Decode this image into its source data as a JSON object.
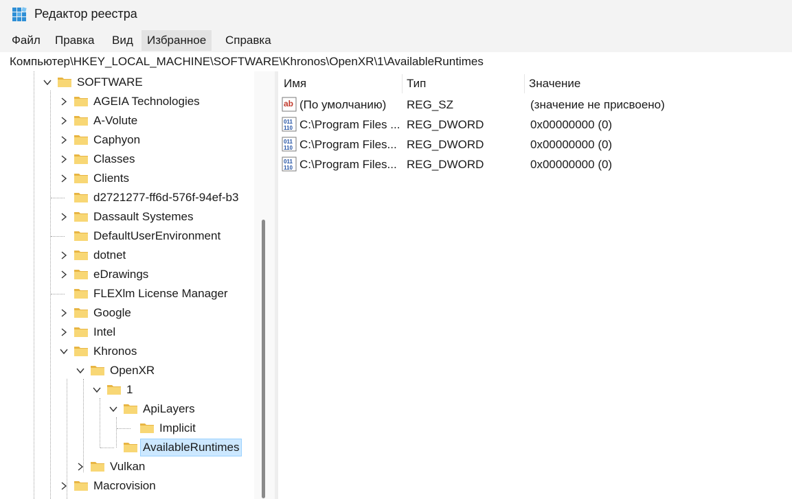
{
  "window": {
    "title": "Редактор реестра"
  },
  "menu": [
    "Файл",
    "Правка",
    "Вид",
    "Избранное",
    "Справка"
  ],
  "address": "Компьютер\\HKEY_LOCAL_MACHINE\\SOFTWARE\\Khronos\\OpenXR\\1\\AvailableRuntimes",
  "tree": {
    "items": [
      {
        "label": "SOFTWARE",
        "level": 0,
        "state": "expanded"
      },
      {
        "label": "AGEIA Technologies",
        "level": 1,
        "state": "collapsed"
      },
      {
        "label": "A-Volute",
        "level": 1,
        "state": "collapsed"
      },
      {
        "label": "Caphyon",
        "level": 1,
        "state": "collapsed"
      },
      {
        "label": "Classes",
        "level": 1,
        "state": "collapsed"
      },
      {
        "label": "Clients",
        "level": 1,
        "state": "collapsed"
      },
      {
        "label": "d2721277-ff6d-576f-94ef-b3",
        "level": 1,
        "state": "leaf"
      },
      {
        "label": "Dassault Systemes",
        "level": 1,
        "state": "collapsed"
      },
      {
        "label": "DefaultUserEnvironment",
        "level": 1,
        "state": "leaf"
      },
      {
        "label": "dotnet",
        "level": 1,
        "state": "collapsed"
      },
      {
        "label": "eDrawings",
        "level": 1,
        "state": "collapsed"
      },
      {
        "label": "FLEXlm License Manager",
        "level": 1,
        "state": "leaf"
      },
      {
        "label": "Google",
        "level": 1,
        "state": "collapsed"
      },
      {
        "label": "Intel",
        "level": 1,
        "state": "collapsed"
      },
      {
        "label": "Khronos",
        "level": 1,
        "state": "expanded"
      },
      {
        "label": "OpenXR",
        "level": 2,
        "state": "expanded"
      },
      {
        "label": "1",
        "level": 3,
        "state": "expanded"
      },
      {
        "label": "ApiLayers",
        "level": 4,
        "state": "expanded"
      },
      {
        "label": "Implicit",
        "level": 5,
        "state": "leaf"
      },
      {
        "label": "AvailableRuntimes",
        "level": 4,
        "state": "leaf",
        "selected": true
      },
      {
        "label": "Vulkan",
        "level": 2,
        "state": "collapsed"
      },
      {
        "label": "Macrovision",
        "level": 1,
        "state": "collapsed"
      }
    ]
  },
  "list": {
    "columns": [
      "Имя",
      "Тип",
      "Значение"
    ],
    "rows": [
      {
        "icon": "string-value-icon",
        "name": "(По умолчанию)",
        "type": "REG_SZ",
        "value": "(значение не присвоено)"
      },
      {
        "icon": "binary-value-icon",
        "name": "C:\\Program Files ...",
        "type": "REG_DWORD",
        "value": "0x00000000 (0)"
      },
      {
        "icon": "binary-value-icon",
        "name": "C:\\Program Files...",
        "type": "REG_DWORD",
        "value": "0x00000000 (0)"
      },
      {
        "icon": "binary-value-icon",
        "name": "C:\\Program Files...",
        "type": "REG_DWORD",
        "value": "0x00000000 (0)"
      }
    ]
  },
  "colors": {
    "folder": "#f8d775",
    "selection": "#cce8ff",
    "accent": "#0078d4"
  }
}
